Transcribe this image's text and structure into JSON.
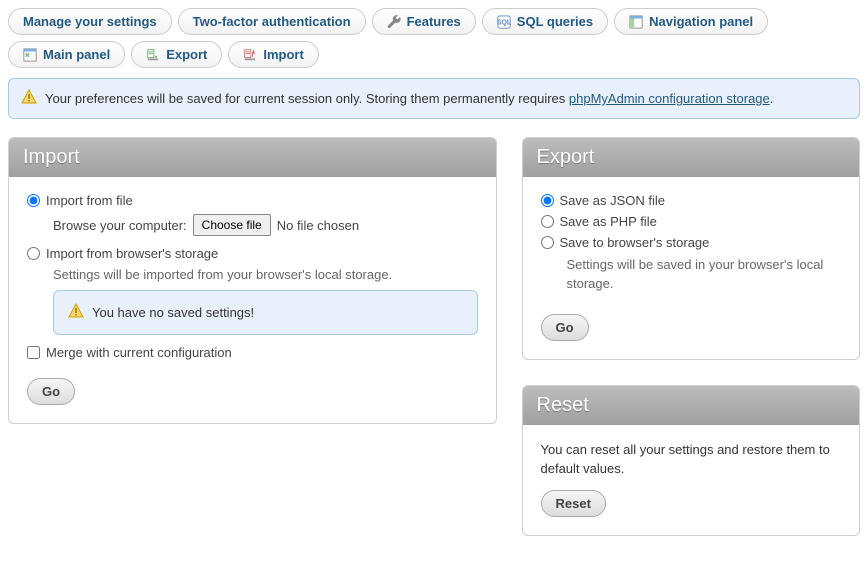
{
  "tabs": {
    "manage": "Manage your settings",
    "twofa": "Two-factor authentication",
    "features": "Features",
    "sql": "SQL queries",
    "nav": "Navigation panel",
    "main": "Main panel",
    "export": "Export",
    "import": "Import"
  },
  "alert": {
    "prefix": "Your preferences will be saved for current session only. Storing them permanently requires ",
    "link": "phpMyAdmin configuration storage",
    "suffix": "."
  },
  "import": {
    "title": "Import",
    "fromFile": "Import from file",
    "browseLabel": "Browse your computer:",
    "chooseFile": "Choose file",
    "noFile": "No file chosen",
    "fromStorage": "Import from browser's storage",
    "storageHint": "Settings will be imported from your browser's local storage.",
    "noSaved": "You have no saved settings!",
    "merge": "Merge with current configuration",
    "go": "Go"
  },
  "export": {
    "title": "Export",
    "json": "Save as JSON file",
    "php": "Save as PHP file",
    "storage": "Save to browser's storage",
    "storageHint": "Settings will be saved in your browser's local storage.",
    "go": "Go"
  },
  "reset": {
    "title": "Reset",
    "text": "You can reset all your settings and restore them to default values.",
    "button": "Reset"
  }
}
